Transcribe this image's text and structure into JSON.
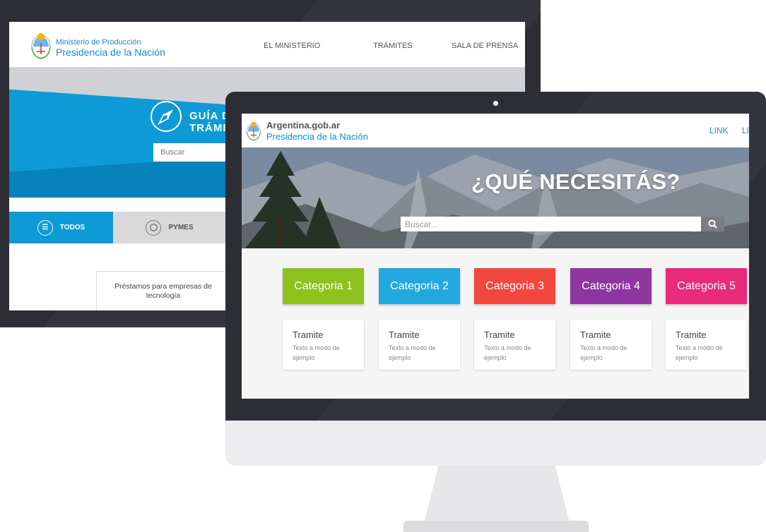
{
  "back_site": {
    "org_small": "Ministerio de Producción",
    "org_big": "Presidencia de la Nación",
    "nav": [
      "EL MINISTERIO",
      "TRÁMITES",
      "SALA DE PRENSA"
    ],
    "guide_line1": "GUÍA D",
    "guide_line2": "TRÁMIT",
    "search_placeholder": "Buscar",
    "tabs": [
      {
        "label": "TODOS",
        "icon": "list-icon"
      },
      {
        "label": "PYMES",
        "icon": "lightbulb-icon"
      }
    ],
    "card_text": "Préstamos para empresas de tecnología"
  },
  "front_site": {
    "site_name": "Argentina.gob.ar",
    "org": "Presidencia de la Nación",
    "links": [
      "LINK",
      "LI"
    ],
    "headline": "¿QUÉ NECESITÁS?",
    "search_placeholder": "Buscar...",
    "search_icon": "search-icon",
    "categories": [
      {
        "label": "Categoria 1",
        "color": "#8dc21f"
      },
      {
        "label": "Categoria 2",
        "color": "#22a7df"
      },
      {
        "label": "Categoria 3",
        "color": "#f2473f"
      },
      {
        "label": "Categoria 4",
        "color": "#8d36a0"
      },
      {
        "label": "Categoria 5",
        "color": "#ea2a7a"
      }
    ],
    "tramites": [
      {
        "title": "Tramite",
        "desc": "Texto a modo de ejemplo"
      },
      {
        "title": "Tramite",
        "desc": "Texto a modo de ejemplo"
      },
      {
        "title": "Tramite",
        "desc": "Texto a modo de ejemplo"
      },
      {
        "title": "Tramite",
        "desc": "Texto a modo de ejemplo"
      },
      {
        "title": "Tramite",
        "desc": "Texto a modo de ejemplo"
      }
    ]
  },
  "colors": {
    "brand_blue": "#0e9ad6",
    "monitor_frame": "#2d2d36"
  }
}
